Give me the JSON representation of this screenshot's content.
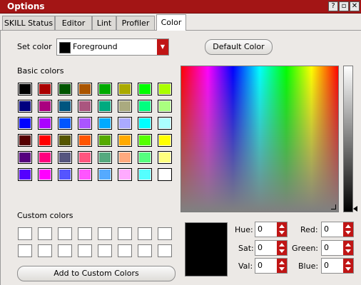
{
  "window": {
    "title": "Options"
  },
  "tabs": [
    "SKILL Status",
    "Editor",
    "Lint",
    "Profiler",
    "Color"
  ],
  "set_color": {
    "label": "Set color",
    "value": "Foreground",
    "swatch": "#000000"
  },
  "default_color_label": "Default Color",
  "basic_colors_label": "Basic colors",
  "basic_colors": [
    [
      "#000000",
      "#aa0000",
      "#005500",
      "#aa5500",
      "#00aa00",
      "#aaaa00",
      "#00ff00",
      "#aaff00"
    ],
    [
      "#00007f",
      "#aa007f",
      "#00557f",
      "#aa557f",
      "#00aa7f",
      "#aaaa7f",
      "#00ff7f",
      "#aaff7f"
    ],
    [
      "#0000ff",
      "#aa00ff",
      "#0055ff",
      "#aa55ff",
      "#00aaff",
      "#aaaaff",
      "#00ffff",
      "#aaffff"
    ],
    [
      "#550000",
      "#ff0000",
      "#555500",
      "#ff5500",
      "#55aa00",
      "#ffaa00",
      "#55ff00",
      "#ffff00"
    ],
    [
      "#55007f",
      "#ff007f",
      "#55557f",
      "#ff557f",
      "#55aa7f",
      "#ffaa7f",
      "#55ff7f",
      "#ffff7f"
    ],
    [
      "#5500ff",
      "#ff00ff",
      "#5555ff",
      "#ff55ff",
      "#55aaff",
      "#ffaaff",
      "#55ffff",
      "#ffffff"
    ]
  ],
  "custom_colors_label": "Custom colors",
  "add_custom_label": "Add to Custom Colors",
  "fields": {
    "hue": {
      "label": "Hue:",
      "value": "0"
    },
    "sat": {
      "label": "Sat:",
      "value": "0"
    },
    "val": {
      "label": "Val:",
      "value": "0"
    },
    "red": {
      "label": "Red:",
      "value": "0"
    },
    "green": {
      "label": "Green:",
      "value": "0"
    },
    "blue": {
      "label": "Blue:",
      "value": "0"
    }
  },
  "selected_color": "#000000",
  "accent": "#c01515"
}
